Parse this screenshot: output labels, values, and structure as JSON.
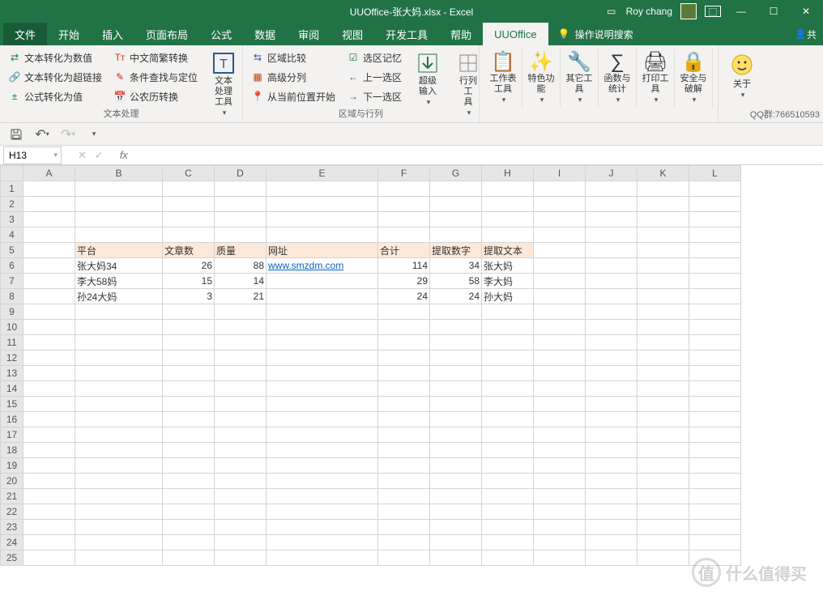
{
  "title": "UUOffice-张大妈.xlsx  -  Excel",
  "user": "Roy chang",
  "tabs": [
    "文件",
    "开始",
    "插入",
    "页面布局",
    "公式",
    "数据",
    "审阅",
    "视图",
    "开发工具",
    "帮助",
    "UUOffice"
  ],
  "active_tab": 10,
  "search_hint": "操作说明搜索",
  "share": "共",
  "qq": "QQ群:766510593",
  "ribbon": {
    "g1": {
      "title": "文本处理",
      "c1": [
        "文本转化为数值",
        "文本转化为超链接",
        "公式转化为值"
      ],
      "c2": [
        "中文简繁转换",
        "条件查找与定位",
        "公农历转换"
      ],
      "big": "文本处理\n工具"
    },
    "g2": {
      "title": "区域与行列",
      "c1": [
        "区域比较",
        "高级分列",
        "从当前位置开始"
      ],
      "c2": [
        "选区记忆",
        "上一选区",
        "下一选区"
      ],
      "big1": "超级\n输入",
      "big2": "行列工\n具"
    },
    "g3": [
      {
        "label": "工作表\n工具"
      },
      {
        "label": "特色功\n能"
      },
      {
        "label": "其它工\n具"
      },
      {
        "label": "函数与\n统计"
      },
      {
        "label": "打印工\n具"
      },
      {
        "label": "安全与\n破解"
      }
    ],
    "about": "关于"
  },
  "name_box": "H13",
  "columns": [
    "A",
    "B",
    "C",
    "D",
    "E",
    "F",
    "G",
    "H",
    "I",
    "J",
    "K",
    "L"
  ],
  "rows": 25,
  "sheet": {
    "header_row": 5,
    "headers": {
      "B": "平台",
      "C": "文章数",
      "D": "质量",
      "E": "网址",
      "F": "合计",
      "G": "提取数字",
      "H": "提取文本"
    },
    "data": [
      {
        "r": 6,
        "B": "张大妈34",
        "C": "26",
        "D": "88",
        "E": "www.smzdm.com",
        "E_link": true,
        "F": "114",
        "G": "34",
        "H": "张大妈"
      },
      {
        "r": 7,
        "B": "李大58妈",
        "C": "15",
        "D": "14",
        "F": "29",
        "G": "58",
        "H": "李大妈"
      },
      {
        "r": 8,
        "B": "孙24大妈",
        "C": "3",
        "D": "21",
        "F": "24",
        "G": "24",
        "H": "孙大妈"
      }
    ]
  },
  "watermark": "什么值得买"
}
